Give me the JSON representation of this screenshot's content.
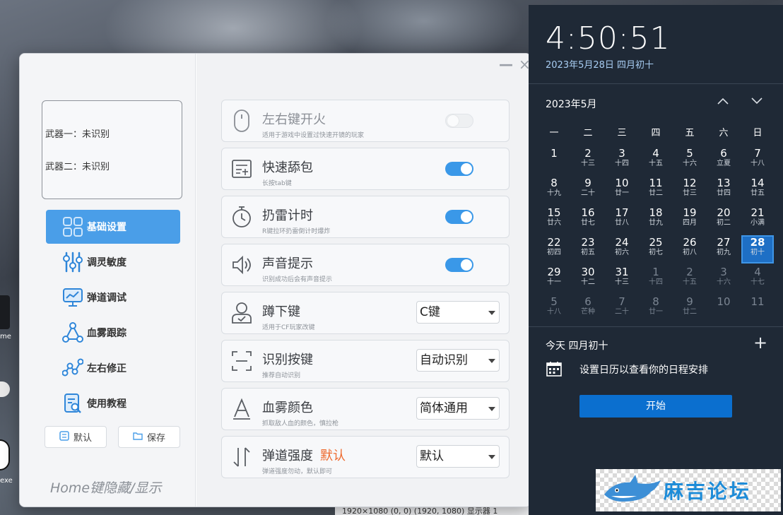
{
  "window": {
    "minimize_glyph": "—",
    "close_glyph": "×"
  },
  "sidebar": {
    "weapon1": "武器一：未识别",
    "weapon2": "武器二：未识别",
    "nav": [
      {
        "label": "基础设置",
        "icon": "grid-settings-icon",
        "active": true
      },
      {
        "label": "调灵敏度",
        "icon": "sliders-icon",
        "active": false
      },
      {
        "label": "弹道调试",
        "icon": "monitor-chart-icon",
        "active": false
      },
      {
        "label": "血雾跟踪",
        "icon": "nodes-triangle-icon",
        "active": false
      },
      {
        "label": "左右修正",
        "icon": "zigzag-nodes-icon",
        "active": false
      },
      {
        "label": "使用教程",
        "icon": "document-search-icon",
        "active": false
      }
    ],
    "default_btn": "默认",
    "save_btn": "保存",
    "home_hint": "Home键隐藏/显示"
  },
  "settings": [
    {
      "title": "左右键开火",
      "sub": "适用于游戏中设置过快速开镜的玩家",
      "icon": "mouse-icon",
      "control": "toggle",
      "enabled": false
    },
    {
      "title": "快速舔包",
      "sub": "长按tab键",
      "icon": "list-box-icon",
      "control": "toggle",
      "enabled": true
    },
    {
      "title": "扔雷计时",
      "sub": "R键拉环扔雷倒计时爆炸",
      "icon": "stopwatch-icon",
      "control": "toggle",
      "enabled": true
    },
    {
      "title": "声音提示",
      "sub": "识别成功后会有声音提示",
      "icon": "speaker-icon",
      "control": "toggle",
      "enabled": true
    },
    {
      "title": "蹲下键",
      "sub": "适用于CF玩家改键",
      "icon": "person-check-icon",
      "control": "select",
      "value": "C键"
    },
    {
      "title": "识别按键",
      "sub": "推荐自动识别",
      "icon": "scan-frame-icon",
      "control": "select",
      "value": "自动识别"
    },
    {
      "title": "血雾颜色",
      "sub": "抓取敌人血的颜色，慎拉枪",
      "icon": "letter-a-icon",
      "control": "select",
      "value": "简体通用"
    },
    {
      "title": "弹道强度",
      "accent": "默认",
      "sub": "弹道强度勿动，默认即可",
      "icon": "up-down-arrows-icon",
      "control": "select",
      "value": "默认"
    }
  ],
  "calendar": {
    "time": "4:50:51",
    "date": "2023年5月28日 四月初十",
    "month": "2023年5月",
    "weekdays": [
      "一",
      "二",
      "三",
      "四",
      "五",
      "六",
      "日"
    ],
    "weeks": [
      [
        {
          "n": "1",
          "l": "",
          "o": false
        },
        {
          "n": "2",
          "l": "十三",
          "o": false
        },
        {
          "n": "3",
          "l": "十四",
          "o": false
        },
        {
          "n": "4",
          "l": "十五",
          "o": false
        },
        {
          "n": "5",
          "l": "十六",
          "o": false
        },
        {
          "n": "6",
          "l": "立夏",
          "o": false
        },
        {
          "n": "7",
          "l": "十八",
          "o": false
        }
      ],
      [
        {
          "n": "8",
          "l": "十九",
          "o": false
        },
        {
          "n": "9",
          "l": "二十",
          "o": false
        },
        {
          "n": "10",
          "l": "廿一",
          "o": false
        },
        {
          "n": "11",
          "l": "廿二",
          "o": false
        },
        {
          "n": "12",
          "l": "廿三",
          "o": false
        },
        {
          "n": "13",
          "l": "廿四",
          "o": false
        },
        {
          "n": "14",
          "l": "廿五",
          "o": false
        }
      ],
      [
        {
          "n": "15",
          "l": "廿六",
          "o": false
        },
        {
          "n": "16",
          "l": "廿七",
          "o": false
        },
        {
          "n": "17",
          "l": "廿八",
          "o": false
        },
        {
          "n": "18",
          "l": "廿九",
          "o": false
        },
        {
          "n": "19",
          "l": "四月",
          "o": false
        },
        {
          "n": "20",
          "l": "初二",
          "o": false
        },
        {
          "n": "21",
          "l": "小满",
          "o": false
        }
      ],
      [
        {
          "n": "22",
          "l": "初四",
          "o": false
        },
        {
          "n": "23",
          "l": "初五",
          "o": false
        },
        {
          "n": "24",
          "l": "初六",
          "o": false
        },
        {
          "n": "25",
          "l": "初七",
          "o": false
        },
        {
          "n": "26",
          "l": "初八",
          "o": false
        },
        {
          "n": "27",
          "l": "初九",
          "o": false
        },
        {
          "n": "28",
          "l": "初十",
          "o": false,
          "today": true
        }
      ],
      [
        {
          "n": "29",
          "l": "十一",
          "o": false
        },
        {
          "n": "30",
          "l": "十二",
          "o": false
        },
        {
          "n": "31",
          "l": "十三",
          "o": false
        },
        {
          "n": "1",
          "l": "十四",
          "o": true
        },
        {
          "n": "2",
          "l": "十五",
          "o": true
        },
        {
          "n": "3",
          "l": "十六",
          "o": true
        },
        {
          "n": "4",
          "l": "十七",
          "o": true
        }
      ],
      [
        {
          "n": "5",
          "l": "十八",
          "o": true
        },
        {
          "n": "6",
          "l": "芒种",
          "o": true
        },
        {
          "n": "7",
          "l": "二十",
          "o": true
        },
        {
          "n": "8",
          "l": "廿一",
          "o": true
        },
        {
          "n": "9",
          "l": "廿二",
          "o": true
        },
        {
          "n": "10",
          "l": "",
          "o": true
        },
        {
          "n": "11",
          "l": "",
          "o": true
        }
      ]
    ],
    "today_label": "今天 四月初十",
    "schedule_text": "设置日历以查看你的日程安排",
    "start_btn": "开始"
  },
  "desktop": {
    "label1": "me",
    "label2": "exe",
    "status_strip": "1920×1080   (0, 0)   (1920, 1080)   显示器 1"
  },
  "watermark": "麻吉论坛",
  "colors": {
    "accent": "#4a9ee8",
    "toggle_on": "#3a98e8",
    "today": "#1e6fc5",
    "flyout_bg": "#1f2936",
    "start_btn": "#0b6fcf",
    "accent_text": "#ee6a2e"
  }
}
